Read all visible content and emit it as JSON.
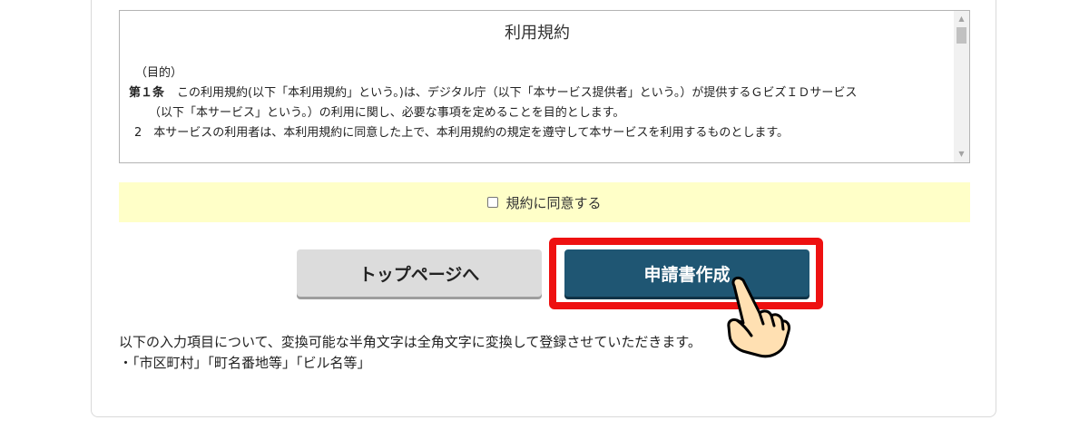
{
  "terms": {
    "title": "利用規約",
    "section_heading": "（目的）",
    "article1_number": "第１条",
    "article1_text": "この利用規約(以下「本利用規約」という。)は、デジタル庁（以下「本サービス提供者」という。）が提供するＧビズＩＤサービス",
    "article1_continuation": "（以下「本サービス」という。）の利用に関し、必要な事項を定めることを目的とします。",
    "article1_para2": "2　本サービスの利用者は、本利用規約に同意した上で、本利用規約の規定を遵守して本サービスを利用するものとします。"
  },
  "agreement": {
    "checkbox_label": "規約に同意する",
    "checked": false
  },
  "buttons": {
    "top_page": "トップページへ",
    "create_application": "申請書作成"
  },
  "notice": {
    "line1": "以下の入力項目について、変換可能な半角文字は全角文字に変換して登録させていただきます。",
    "line2": "・「市区町村」「町名番地等」「ビル名等」"
  },
  "colors": {
    "primary_button": "#1f5673",
    "secondary_button": "#dcdcdc",
    "highlight": "#ee1111",
    "agree_background": "#ffffc8"
  }
}
